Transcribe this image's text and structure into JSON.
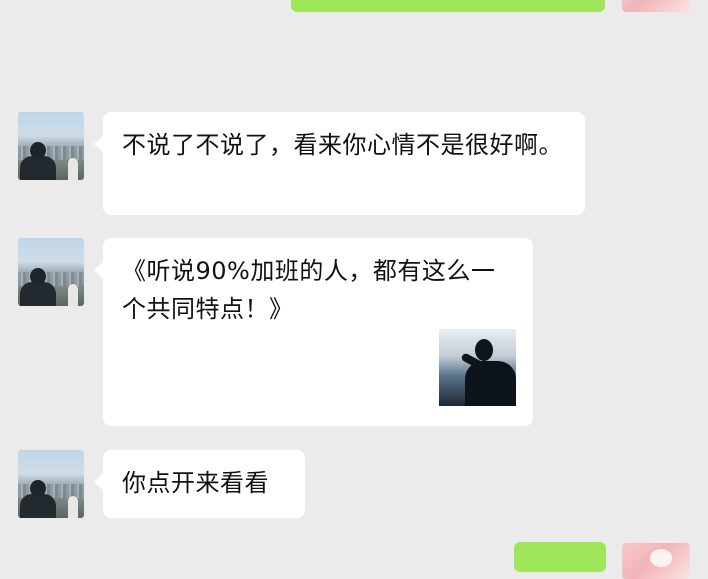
{
  "chat": {
    "messages": [
      {
        "sender": "friend",
        "text": "不说了不说了，看来你心情不是很好啊。"
      },
      {
        "sender": "friend",
        "text": "《听说90%加班的人，都有这么一个共同特点！》",
        "has_thumbnail": true,
        "thumbnail_icon": "article-thumbnail-icon"
      },
      {
        "sender": "friend",
        "text": "你点开来看看"
      }
    ]
  },
  "colors": {
    "background": "#ebebeb",
    "incoming_bubble": "#ffffff",
    "outgoing_bubble": "#9fe65a"
  }
}
